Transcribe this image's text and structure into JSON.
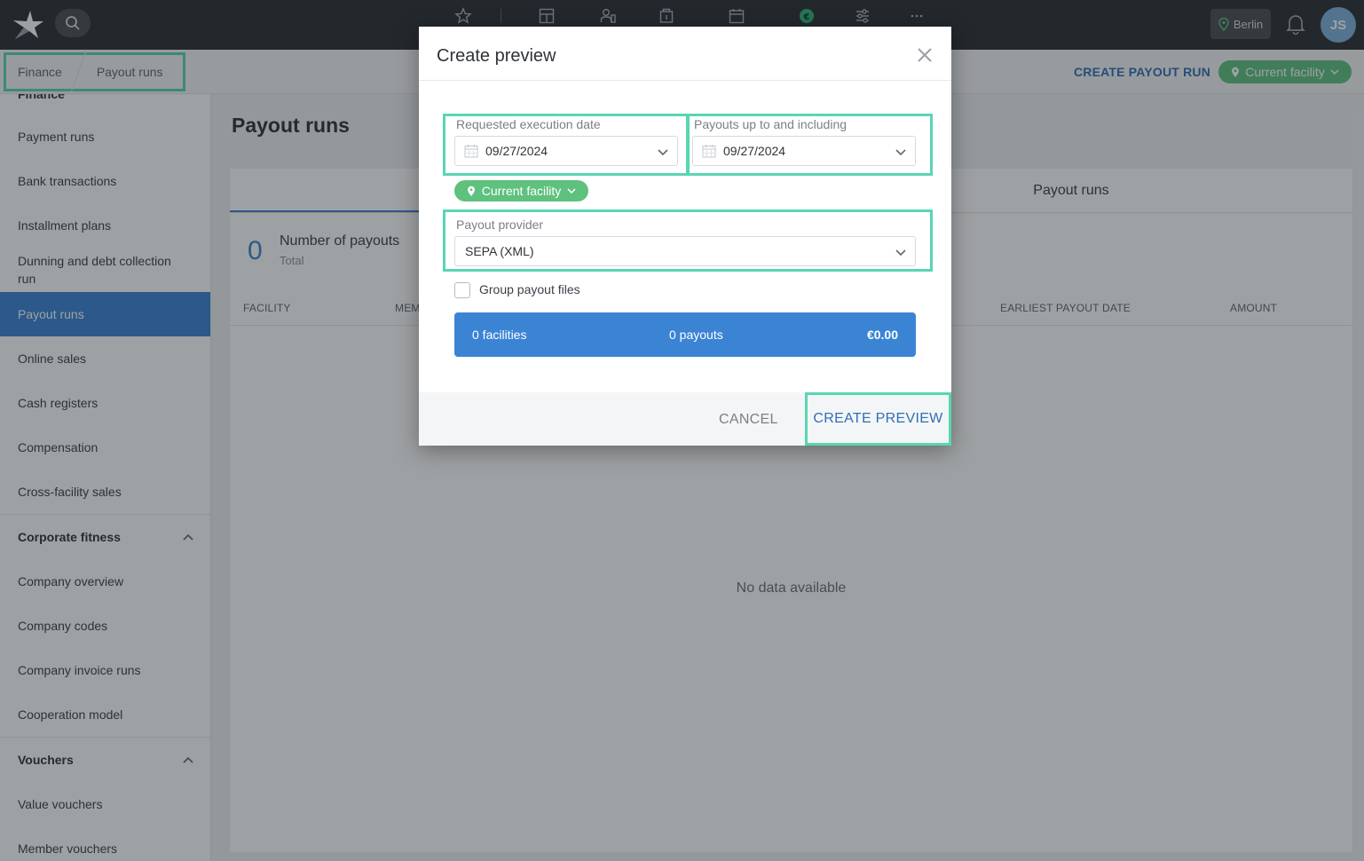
{
  "topbar": {
    "icons": [
      "logo-icon",
      "search-icon",
      "star-icon",
      "dashboard-icon",
      "members-icon",
      "checkin-icon",
      "calendar-icon",
      "finance-icon",
      "settings-sliders-icon",
      "more-icon",
      "bell-icon"
    ],
    "location": "Berlin",
    "avatar_initials": "JS"
  },
  "subheader": {
    "breadcrumb": [
      "Finance",
      "Payout runs"
    ],
    "create_payout_run": "CREATE PAYOUT RUN",
    "facility_filter": "Current facility"
  },
  "sidebar": {
    "partial_top": "Finance",
    "finance_items": [
      "Payment runs",
      "Bank transactions",
      "Installment plans",
      "Dunning and debt collection run",
      "Payout runs",
      "Online sales",
      "Cash registers",
      "Compensation",
      "Cross-facility sales"
    ],
    "active_item": "Payout runs",
    "groups": [
      {
        "label": "Corporate fitness",
        "items": [
          "Company overview",
          "Company codes",
          "Company invoice runs",
          "Cooperation model"
        ]
      },
      {
        "label": "Vouchers",
        "items": [
          "Value vouchers",
          "Member vouchers"
        ]
      }
    ]
  },
  "main": {
    "title": "Payout runs",
    "tab_right": "Payout runs",
    "stat": {
      "value": "0",
      "label": "Number of payouts",
      "sub": "Total"
    },
    "columns": [
      "FACILITY",
      "MEM",
      "EARLIEST PAYOUT DATE",
      "AMOUNT"
    ],
    "empty": "No data available"
  },
  "modal": {
    "title": "Create preview",
    "requested_date_label": "Requested execution date",
    "requested_date_value": "09/27/2024",
    "payouts_until_label": "Payouts up to and including",
    "payouts_until_value": "09/27/2024",
    "facility_pill": "Current facility",
    "provider_label": "Payout provider",
    "provider_value": "SEPA (XML)",
    "group_files_label": "Group payout files",
    "summary": {
      "facilities": "0 facilities",
      "payouts": "0 payouts",
      "amount": "€0.00"
    },
    "cancel": "CANCEL",
    "create": "CREATE PREVIEW"
  },
  "colors": {
    "accent": "#3b84d4",
    "facility_green": "#5fc17e",
    "highlight": "#58d6b3",
    "topbar": "#2c3034"
  }
}
